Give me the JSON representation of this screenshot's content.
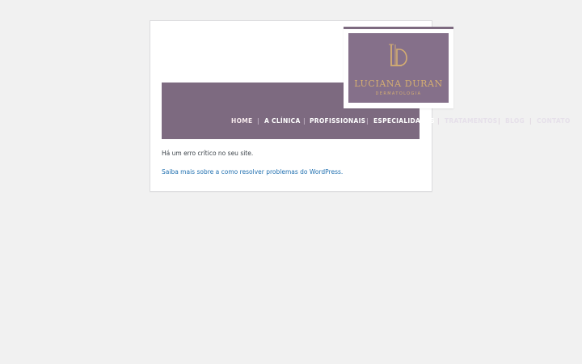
{
  "logo": {
    "name": "LUCIANA DURAN",
    "subtitle": "DERMATOLOGIA",
    "monogram_icon": "ld-monogram-icon",
    "colors": {
      "brand_purple": "#7d6a80",
      "gold": "#d4ad72"
    }
  },
  "nav": {
    "items": [
      {
        "label": "HOME"
      },
      {
        "label": "A CLÍNICA"
      },
      {
        "label": "PROFISSIONAIS"
      },
      {
        "label": "ESPECIALIDADES"
      },
      {
        "label": "TRATAMENTOS"
      },
      {
        "label": "BLOG"
      },
      {
        "label": "CONTATO"
      }
    ],
    "separator": "|"
  },
  "error": {
    "message": "Há um erro crítico no seu site.",
    "help_link": "Saiba mais sobre a como resolver problemas do WordPress."
  }
}
